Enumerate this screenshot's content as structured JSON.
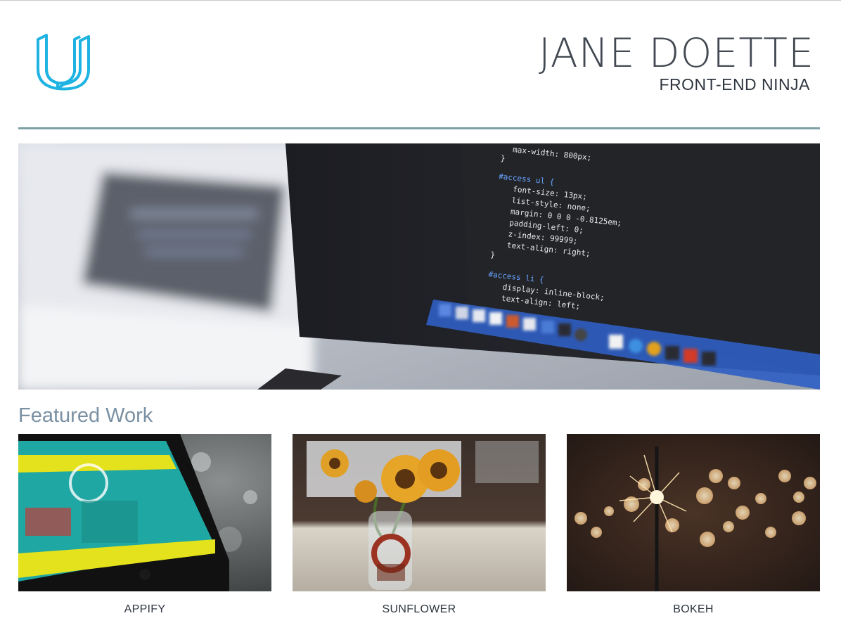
{
  "header": {
    "name": "JANE DOETTE",
    "role": "FRONT-END NINJA",
    "logo_icon": "udacity-u-logo",
    "accent_color": "#1eb3e2",
    "divider_color": "#7fa1a6"
  },
  "hero": {
    "image": "laptop-code-photo",
    "code_lines": [
      "max-width: 800px;",
      "}",
      "#access ul {",
      "font-size: 13px;",
      "list-style: none;",
      "margin: 0 0 0 -0.8125em;",
      "padding-left: 0;",
      "z-index: 99999;",
      "text-align: right;",
      "}",
      "#access li {",
      "display: inline-block;",
      "text-align: left;"
    ]
  },
  "featured": {
    "title": "Featured Work",
    "title_color": "#7a90a3",
    "items": [
      {
        "caption": "APPIFY",
        "image": "phone-app-photo"
      },
      {
        "caption": "SUNFLOWER",
        "image": "sunflower-vase-photo"
      },
      {
        "caption": "BOKEH",
        "image": "sparkler-bokeh-photo"
      }
    ]
  }
}
